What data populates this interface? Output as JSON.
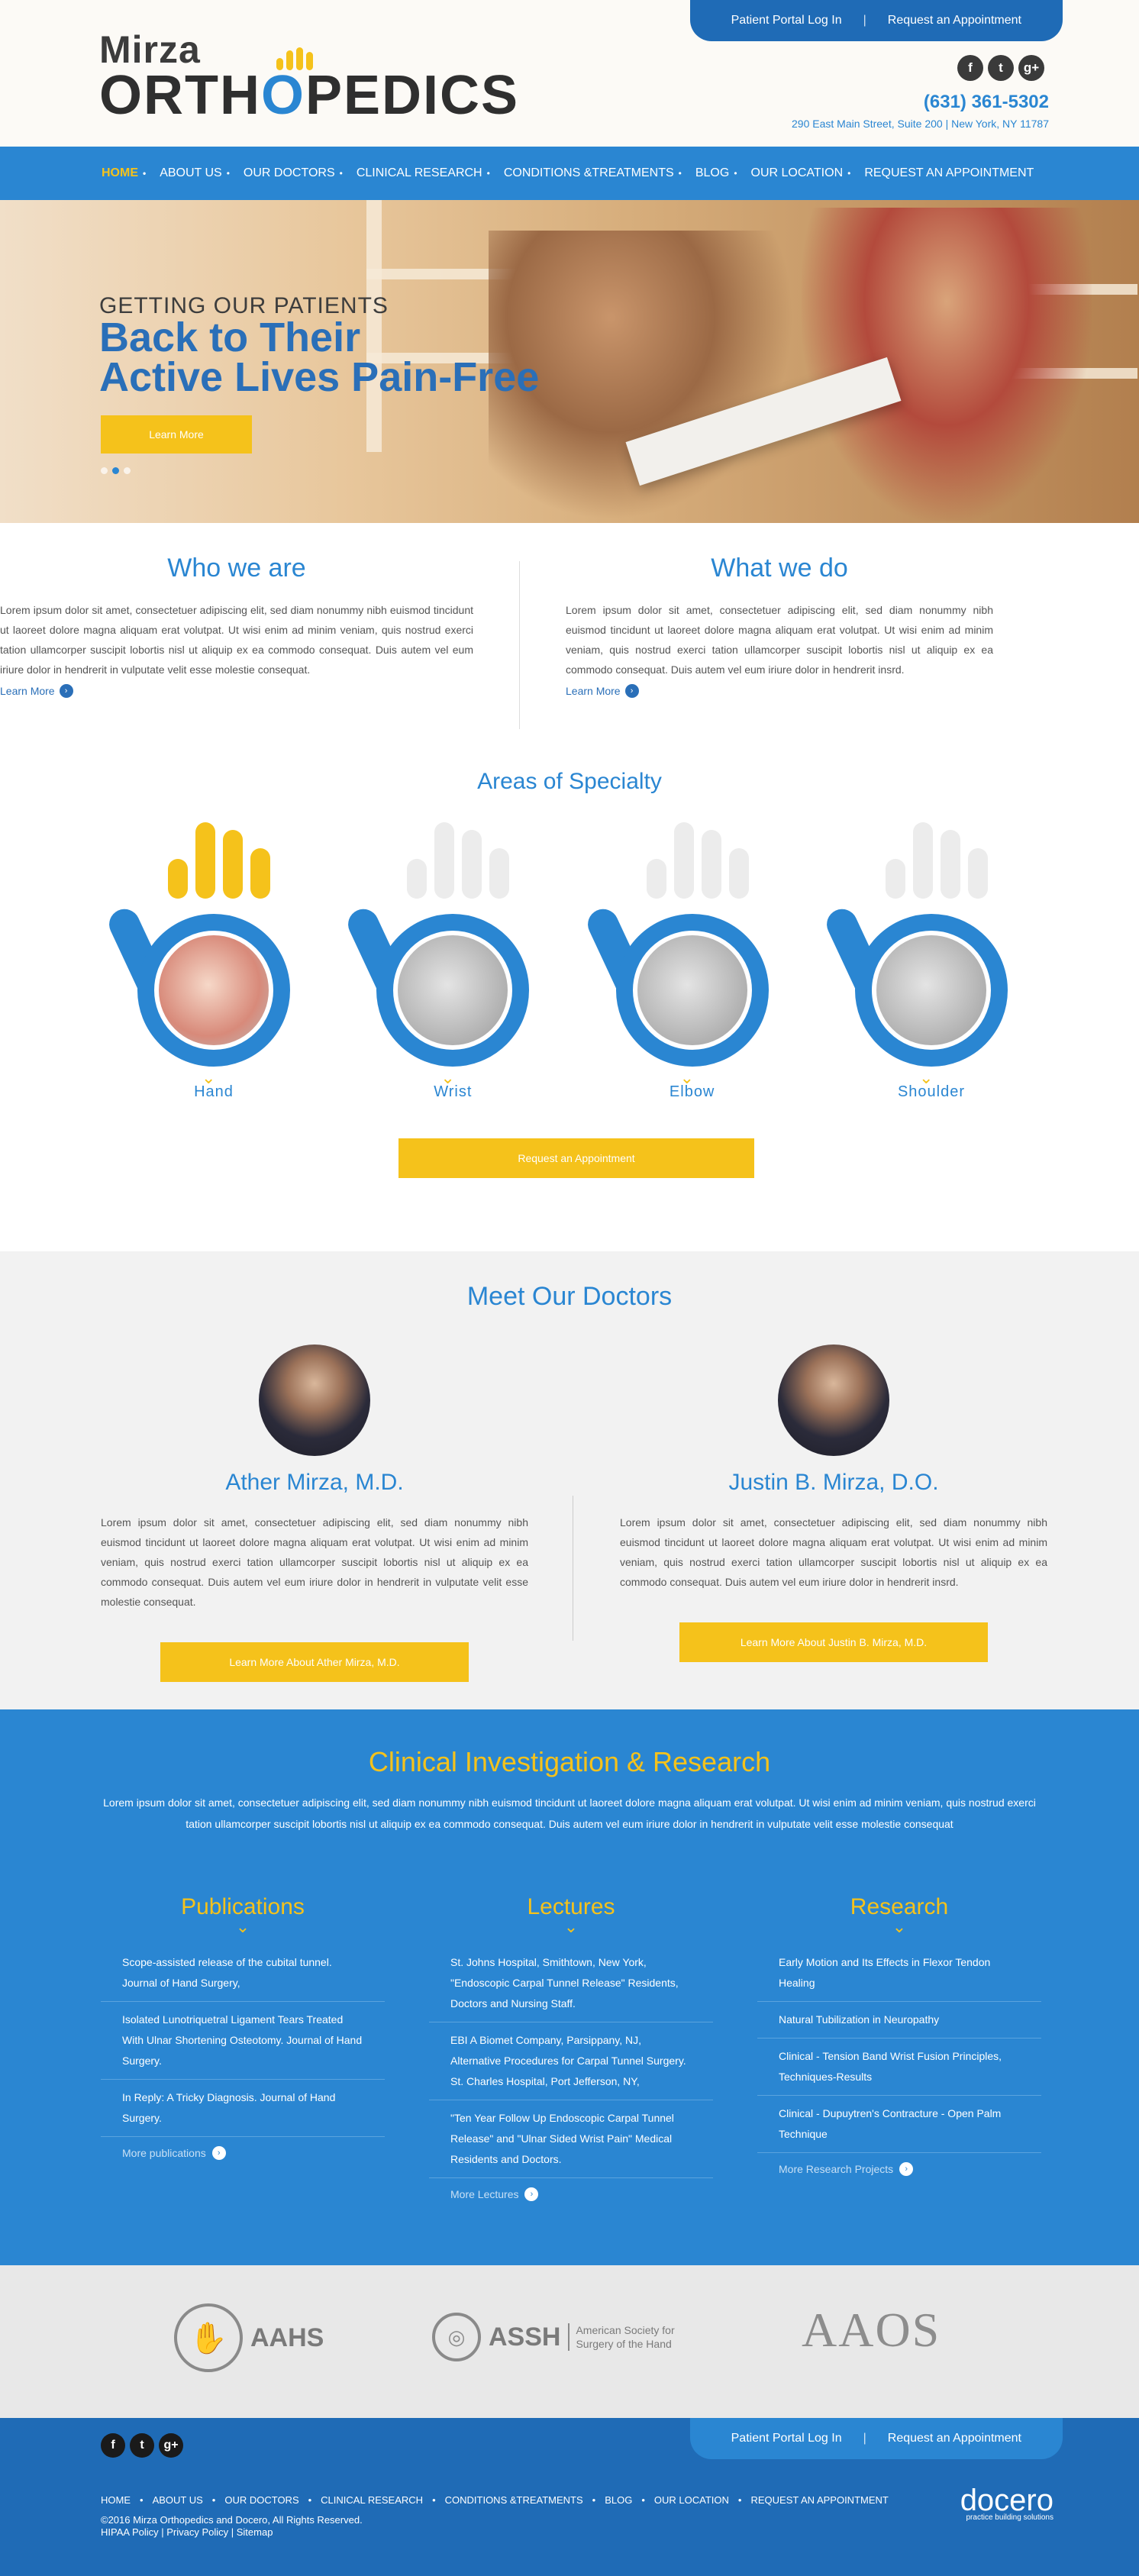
{
  "header": {
    "portal": "Patient Portal Log In",
    "request": "Request an Appointment",
    "separator": "|",
    "logo_top": "Mirza",
    "logo_bottom_a": "ORTH",
    "logo_bottom_o": "O",
    "logo_bottom_b": "PEDICS",
    "phone": "(631) 361-5302",
    "address": "290 East Main Street, Suite 200 | New York, NY 11787",
    "social": [
      "f",
      "t",
      "g+"
    ]
  },
  "nav": {
    "items": [
      "HOME",
      "ABOUT US",
      "OUR DOCTORS",
      "CLINICAL RESEARCH",
      "CONDITIONS &TREATMENTS",
      "BLOG",
      "OUR LOCATION",
      "REQUEST AN APPOINTMENT"
    ]
  },
  "hero": {
    "sub": "GETTING OUR PATIENTS",
    "title1": "Back to Their",
    "title2": "Active Lives Pain-Free",
    "button": "Learn More"
  },
  "who": {
    "title": "Who we are",
    "text": "Lorem ipsum dolor sit amet, consectetuer adipiscing elit, sed diam nonummy nibh euismod tincidunt ut laoreet dolore magna aliquam erat volutpat. Ut wisi enim ad minim veniam, quis nostrud exerci tation ullamcorper suscipit lobortis nisl ut aliquip ex ea commodo consequat. Duis autem vel eum iriure dolor in hendrerit in vulputate velit esse molestie consequat.",
    "more": "Learn More"
  },
  "what": {
    "title": "What we do",
    "text": "Lorem ipsum dolor sit amet, consectetuer adipiscing elit, sed diam nonummy nibh euismod tincidunt ut laoreet dolore magna aliquam erat volutpat. Ut wisi enim ad minim veniam, quis nostrud exerci tation ullamcorper suscipit lobortis nisl ut aliquip ex ea commodo consequat. Duis autem vel eum iriure dolor in hendrerit insrd.",
    "more": "Learn More"
  },
  "specialty": {
    "title": "Areas of Specialty",
    "items": [
      "Hand",
      "Wrist",
      "Elbow",
      "Shoulder"
    ],
    "button": "Request an Appointment"
  },
  "doctors": {
    "title": "Meet Our Doctors",
    "list": [
      {
        "name": "Ather Mirza, M.D.",
        "text": "Lorem ipsum dolor sit amet, consectetuer adipiscing elit, sed diam nonummy nibh euismod tincidunt ut laoreet dolore magna aliquam erat volutpat. Ut wisi enim ad minim veniam, quis nostrud exerci tation ullamcorper suscipit lobortis nisl ut aliquip ex ea commodo consequat. Duis autem vel eum iriure dolor in hendrerit in vulputate velit esse molestie consequat.",
        "button": "Learn More About Ather Mirza, M.D."
      },
      {
        "name": "Justin B. Mirza, D.O.",
        "text": "Lorem ipsum dolor sit amet, consectetuer adipiscing elit, sed diam nonummy nibh euismod tincidunt ut laoreet dolore magna aliquam erat volutpat. Ut wisi enim ad minim veniam, quis nostrud exerci tation ullamcorper suscipit lobortis nisl ut aliquip ex ea commodo consequat. Duis autem vel eum iriure dolor in hendrerit insrd.",
        "button": "Learn More About Justin B. Mirza, M.D."
      }
    ]
  },
  "clinical": {
    "title": "Clinical Investigation & Research",
    "intro": "Lorem ipsum dolor sit amet, consectetuer adipiscing elit, sed diam nonummy nibh euismod tincidunt ut laoreet dolore magna aliquam erat volutpat. Ut wisi enim ad minim veniam, quis nostrud exerci tation ullamcorper suscipit lobortis nisl ut aliquip ex ea commodo consequat. Duis autem vel eum iriure dolor in hendrerit in vulputate velit esse molestie consequat",
    "publications": {
      "title": "Publications",
      "items": [
        "Scope-assisted release of the cubital tunnel. Journal of Hand Surgery,",
        "Isolated Lunotriquetral Ligament Tears Treated With Ulnar Shortening Osteotomy. Journal of Hand Surgery.",
        "In Reply: A Tricky Diagnosis. Journal of Hand Surgery."
      ],
      "more": "More publications"
    },
    "lectures": {
      "title": "Lectures",
      "items": [
        "St. Johns Hospital, Smithtown, New York, \"Endoscopic Carpal Tunnel Release\" Residents, Doctors and Nursing Staff.",
        "EBI A Biomet Company, Parsippany, NJ, Alternative Procedures for Carpal Tunnel Surgery. St. Charles Hospital, Port Jefferson, NY,",
        "\"Ten Year Follow Up Endoscopic Carpal Tunnel Release\" and \"Ulnar Sided Wrist Pain\" Medical Residents and Doctors."
      ],
      "more": "More Lectures"
    },
    "research": {
      "title": "Research",
      "items": [
        "Early Motion and Its Effects in Flexor Tendon Healing",
        "Natural Tubilization in Neuropathy",
        "Clinical - Tension Band Wrist Fusion Principles, Techniques-Results",
        "Clinical - Dupuytren's Contracture - Open Palm Technique"
      ],
      "more": "More Research Projects"
    }
  },
  "assoc": {
    "aahs": "AAHS",
    "assh": "ASSH",
    "assh_full": "American Society for Surgery of the Hand",
    "aaos": "AAOS"
  },
  "footer": {
    "portal": "Patient Portal Log In",
    "request": "Request an Appointment",
    "separator": "|",
    "nav": [
      "HOME",
      "ABOUT US",
      "OUR DOCTORS",
      "CLINICAL RESEARCH",
      "CONDITIONS &TREATMENTS",
      "BLOG",
      "OUR LOCATION",
      "REQUEST AN APPOINTMENT"
    ],
    "copyright": "©2016 Mirza Orthopedics and Docero, All Rights Reserved.",
    "links": "HIPAA Policy | Privacy Policy | Sitemap",
    "brand": "docero",
    "brand_tag": "practice building solutions",
    "social": [
      "f",
      "t",
      "g+"
    ]
  }
}
